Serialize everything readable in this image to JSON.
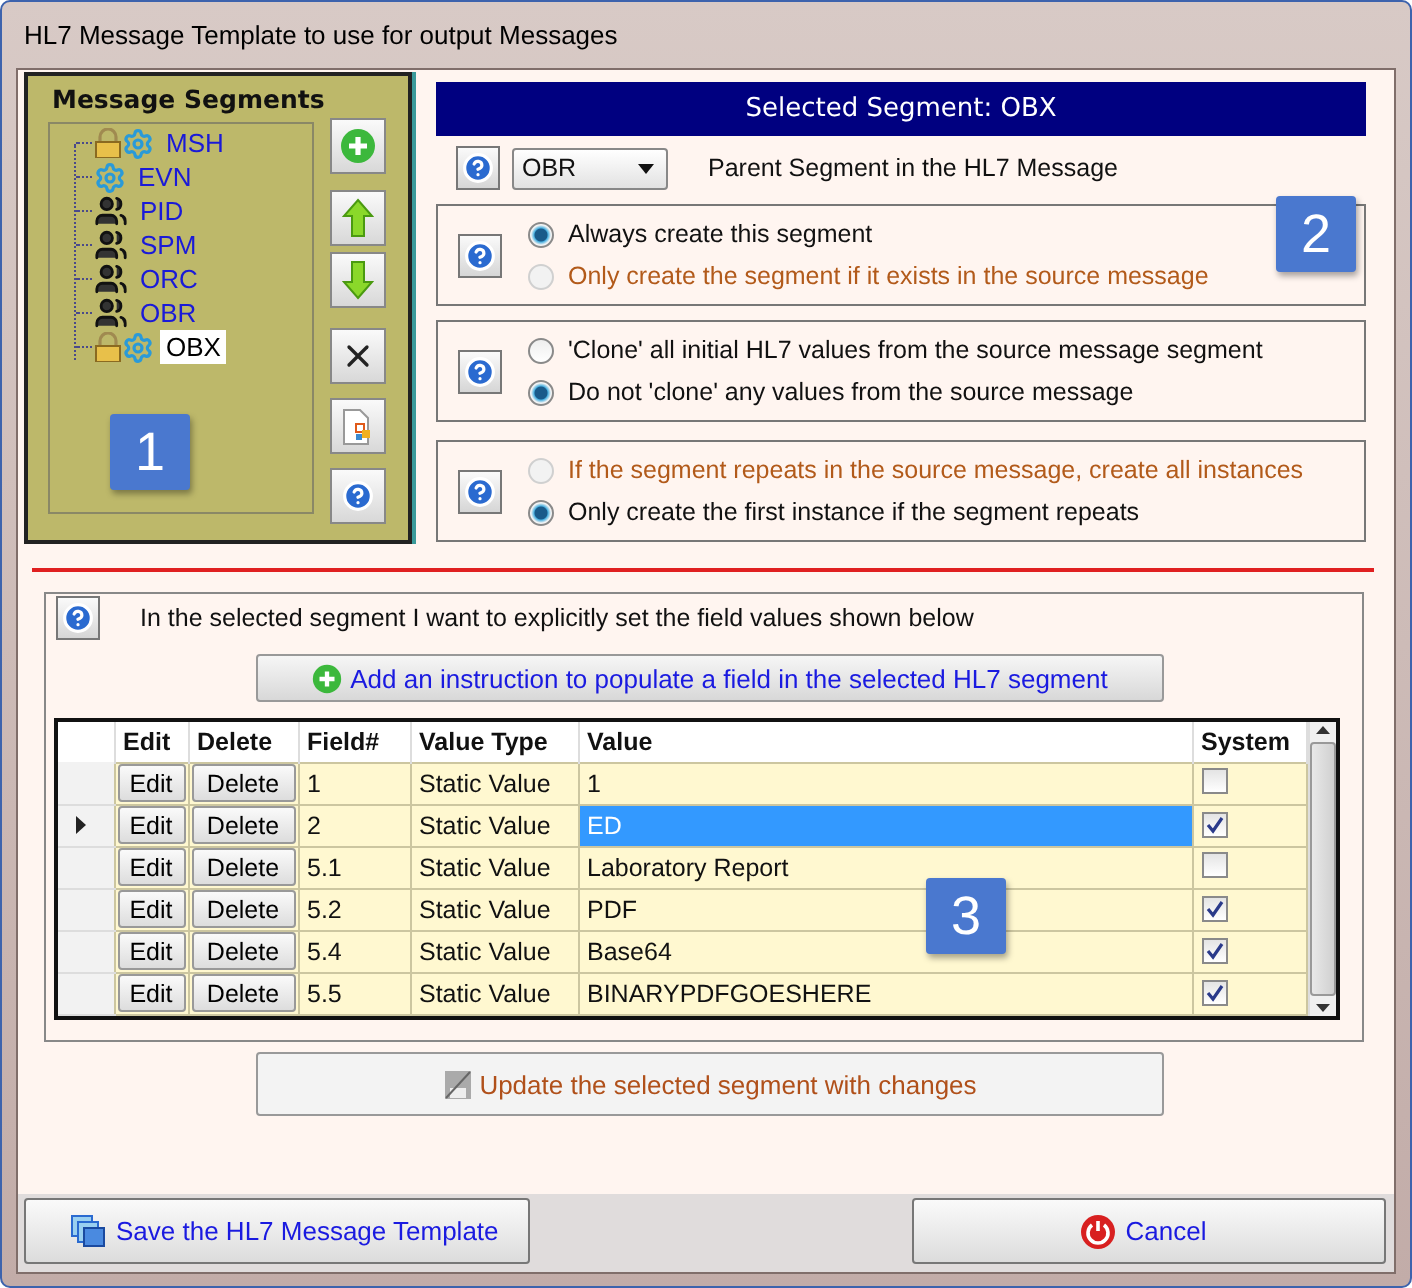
{
  "window": {
    "title": "HL7 Message Template to use for output Messages"
  },
  "segments_panel": {
    "title": "Message Segments",
    "badge": "1",
    "items": [
      {
        "label": "MSH",
        "kind": "locked",
        "selected": false
      },
      {
        "label": "EVN",
        "kind": "config",
        "selected": false
      },
      {
        "label": "PID",
        "kind": "group",
        "selected": false
      },
      {
        "label": "SPM",
        "kind": "group",
        "selected": false
      },
      {
        "label": "ORC",
        "kind": "group",
        "selected": false
      },
      {
        "label": "OBR",
        "kind": "group",
        "selected": false
      },
      {
        "label": "OBX",
        "kind": "locked",
        "selected": true
      }
    ]
  },
  "selected_segment": {
    "title": "Selected Segment: OBX",
    "badge": "2",
    "parent": {
      "value": "OBR",
      "label": "Parent Segment in the HL7 Message"
    },
    "option_groups": [
      {
        "options": [
          {
            "label": "Always create this segment",
            "selected": true,
            "disabled": false
          },
          {
            "label": "Only create the segment if it exists in the source message",
            "selected": false,
            "disabled": true
          }
        ]
      },
      {
        "options": [
          {
            "label": "'Clone' all initial HL7 values from the source message segment",
            "selected": false,
            "disabled": false
          },
          {
            "label": "Do not 'clone' any values from the source message",
            "selected": true,
            "disabled": false
          }
        ]
      },
      {
        "options": [
          {
            "label": "If the segment repeats in the source message, create all instances",
            "selected": false,
            "disabled": true
          },
          {
            "label": "Only create the first instance if the segment repeats",
            "selected": true,
            "disabled": false
          }
        ]
      }
    ]
  },
  "fields_section": {
    "description": "In the selected segment  I want to explicitly set the field values shown below",
    "add_button": "Add an instruction to populate a field in the selected HL7 segment",
    "badge": "3",
    "table": {
      "columns": [
        "Edit",
        "Delete",
        "Field#",
        "Value Type",
        "Value",
        "System"
      ],
      "rows": [
        {
          "edit": "Edit",
          "delete": "Delete",
          "field": "1",
          "value_type": "Static Value",
          "value": "1",
          "system": false,
          "selected": false
        },
        {
          "edit": "Edit",
          "delete": "Delete",
          "field": "2",
          "value_type": "Static Value",
          "value": "ED",
          "system": true,
          "selected": true
        },
        {
          "edit": "Edit",
          "delete": "Delete",
          "field": "5.1",
          "value_type": "Static Value",
          "value": "Laboratory Report",
          "system": false,
          "selected": false
        },
        {
          "edit": "Edit",
          "delete": "Delete",
          "field": "5.2",
          "value_type": "Static Value",
          "value": "PDF",
          "system": true,
          "selected": false
        },
        {
          "edit": "Edit",
          "delete": "Delete",
          "field": "5.4",
          "value_type": "Static Value",
          "value": "Base64",
          "system": true,
          "selected": false
        },
        {
          "edit": "Edit",
          "delete": "Delete",
          "field": "5.5",
          "value_type": "Static Value",
          "value": "BINARYPDFGOESHERE",
          "system": true,
          "selected": false
        }
      ]
    }
  },
  "update_button": {
    "label": "Update the selected segment with changes",
    "disabled": true
  },
  "footer": {
    "save_button": "Save the HL7 Message Template",
    "cancel_button": "Cancel"
  }
}
